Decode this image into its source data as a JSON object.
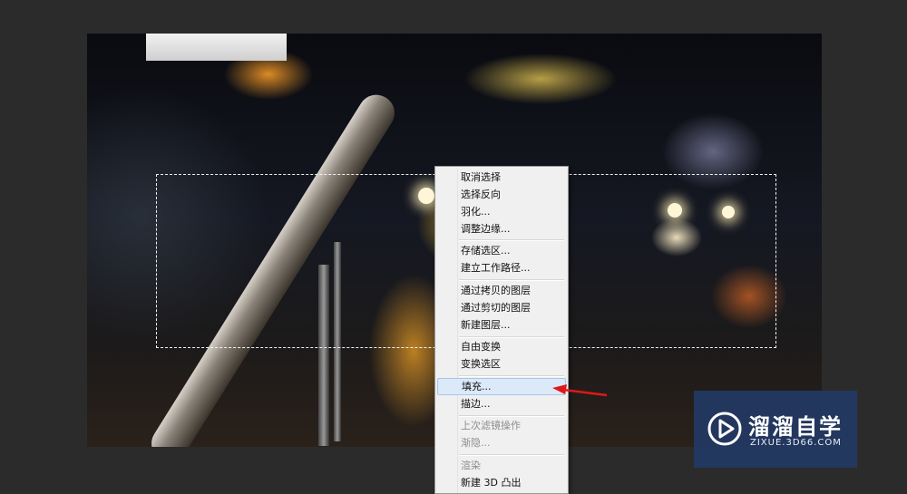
{
  "context_menu": {
    "items": [
      {
        "label": "取消选择",
        "enabled": true
      },
      {
        "label": "选择反向",
        "enabled": true
      },
      {
        "label": "羽化...",
        "enabled": true
      },
      {
        "label": "调整边缘...",
        "enabled": true
      },
      {
        "label": "存储选区...",
        "enabled": true
      },
      {
        "label": "建立工作路径...",
        "enabled": true
      },
      {
        "label": "通过拷贝的图层",
        "enabled": true
      },
      {
        "label": "通过剪切的图层",
        "enabled": true
      },
      {
        "label": "新建图层...",
        "enabled": true
      },
      {
        "label": "自由变换",
        "enabled": true
      },
      {
        "label": "变换选区",
        "enabled": true
      },
      {
        "label": "填充...",
        "enabled": true,
        "highlighted": true
      },
      {
        "label": "描边...",
        "enabled": true
      },
      {
        "label": "上次滤镜操作",
        "enabled": false
      },
      {
        "label": "渐隐...",
        "enabled": false
      },
      {
        "label": "渲染",
        "enabled": false
      },
      {
        "label": "新建 3D 凸出",
        "enabled": true
      }
    ]
  },
  "annotation": {
    "arrow_color": "#e01818",
    "points_to": "填充..."
  },
  "watermark": {
    "title": "溜溜自学",
    "url": "ZIXUE.3D66.COM"
  },
  "colors": {
    "workspace": "#2b2b2b",
    "menu_bg": "#f0f0f0",
    "highlight": "#dce9f8",
    "watermark_bg": "#233a64"
  }
}
